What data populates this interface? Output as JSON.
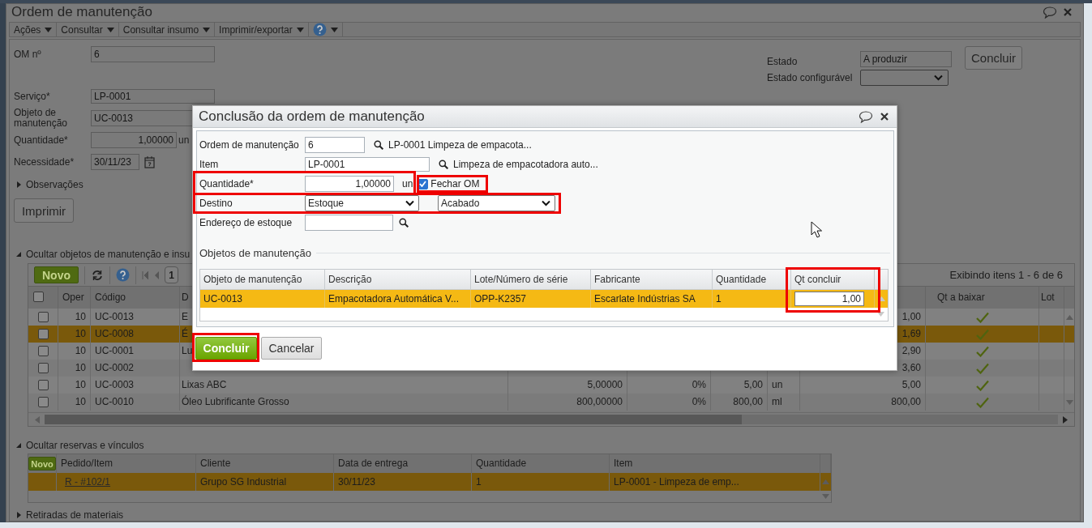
{
  "window": {
    "title": "Ordem de manutenção"
  },
  "menu": [
    {
      "label": "Ações"
    },
    {
      "label": "Consultar"
    },
    {
      "label": "Consultar insumo"
    },
    {
      "label": "Imprimir/exportar"
    }
  ],
  "form": {
    "om": {
      "label": "OM nº",
      "value": "6"
    },
    "servico": {
      "label": "Serviço*",
      "value": "LP-0001"
    },
    "objeto": {
      "label": "Objeto de manutenção",
      "value": "UC-0013"
    },
    "quantidade": {
      "label": "Quantidade*",
      "value": "1,00000",
      "unit": "un"
    },
    "necessidade": {
      "label": "Necessidade*",
      "value": "30/11/23"
    },
    "observacoes": {
      "label": "Observações",
      "expanded": false
    },
    "print_button": "Imprimir",
    "estado": {
      "label": "Estado",
      "value": "A produzir"
    },
    "conclude_button": "Concluir",
    "estado_configuravel": {
      "label": "Estado configurável"
    }
  },
  "objects_section": {
    "title": "Ocultar objetos de manutenção e insu",
    "expanded": true,
    "new_button": "Novo",
    "page": "1",
    "info": "Exibindo itens 1 - 6 de 6",
    "select_all": {
      "checked": false
    },
    "columns": {
      "oper": "Oper",
      "codigo": "Código",
      "descricao": "D",
      "qt_a_baixar": "Qt a baixar",
      "lote": "Lot"
    },
    "rows": [
      {
        "checked": false,
        "selected": false,
        "oper": "10",
        "codigo": "UC-0013",
        "descricao": "E",
        "column_9": "1,00"
      },
      {
        "checked": false,
        "selected": true,
        "oper": "10",
        "codigo": "UC-0008",
        "descricao": "É",
        "column_9": "1,69"
      },
      {
        "checked": false,
        "selected": false,
        "oper": "10",
        "codigo": "UC-0001",
        "descricao": "Lu",
        "column_9": "2,90"
      },
      {
        "checked": false,
        "selected": false,
        "oper": "10",
        "codigo": "UC-0002",
        "column_9": "3,60"
      },
      {
        "checked": false,
        "selected": false,
        "oper": "10",
        "codigo": "UC-0003",
        "descricao": "Lixas ABC",
        "column_5": "5,00000",
        "column_6": "0%",
        "column_7": "5,00",
        "column_8": "un",
        "column_9": "5,00"
      },
      {
        "checked": false,
        "selected": false,
        "oper": "10",
        "codigo": "UC-0010",
        "descricao": "Óleo Lubrificante Grosso",
        "column_5": "800,00000",
        "column_6": "0%",
        "column_7": "800,00",
        "column_8": "ml",
        "column_9": "800,00"
      }
    ]
  },
  "reservations_section": {
    "title": "Ocultar reservas e vínculos",
    "expanded": true,
    "new_button": "Novo",
    "columns": [
      "Pedido/Item",
      "Cliente",
      "Data de entrega",
      "Quantidade",
      "Item"
    ],
    "rows": [
      {
        "selected": true,
        "cells": [
          "R - #102/1",
          "Grupo SG Industrial",
          "30/11/23",
          "1",
          "LP-0001 - Limpeza de emp..."
        ]
      }
    ]
  },
  "withdrawals_section": {
    "title": "Retiradas de materiais",
    "expanded": false
  },
  "dialog": {
    "title": "Conclusão da ordem de manutenção",
    "ordem": {
      "label": "Ordem de manutenção",
      "value": "6",
      "description": "LP-0001 Limpeza de empacota..."
    },
    "item": {
      "label": "Item",
      "value": "LP-0001",
      "description": "Limpeza de empacotadora auto..."
    },
    "quantidade": {
      "label": "Quantidade*",
      "value": "1,00000",
      "unit": "un"
    },
    "fechar_om": {
      "label": "Fechar OM",
      "checked": true
    },
    "destino": {
      "label": "Destino",
      "value": "Estoque",
      "value_2": "Acabado"
    },
    "endereco": {
      "label": "Endereço de estoque"
    },
    "objects": {
      "legend": "Objetos de manutenção",
      "columns": [
        "Objeto de manutenção",
        "Descrição",
        "Lote/Número de série",
        "Fabricante",
        "Quantidade",
        "Qt concluir"
      ],
      "rows": [
        {
          "selected": true,
          "cells": [
            "UC-0013",
            "Empacotadora Automática V...",
            "OPP-K2357",
            "Escarlate Indústrias SA",
            "1"
          ],
          "qt_concluir": "1,00"
        }
      ]
    },
    "buttons": [
      {
        "label": "Concluir",
        "kind": "primary"
      },
      {
        "label": "Cancelar",
        "kind": "secondary"
      }
    ]
  }
}
